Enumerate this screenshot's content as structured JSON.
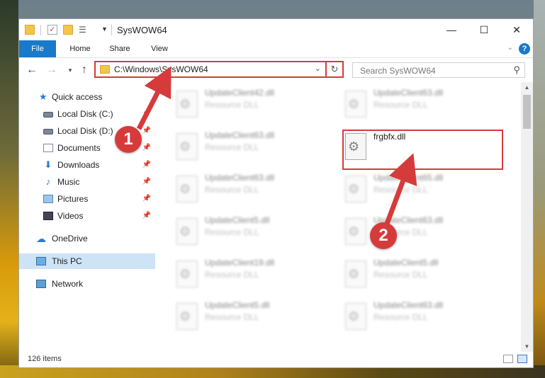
{
  "window": {
    "title": "SysWOW64",
    "controls": {
      "minimize": "—",
      "maximize": "☐",
      "close": "✕"
    }
  },
  "ribbon": {
    "tabs": [
      "File",
      "Home",
      "Share",
      "View"
    ]
  },
  "address": {
    "path": "C:\\Windows\\SysWOW64",
    "search_placeholder": "Search SysWOW64"
  },
  "nav": {
    "items": [
      {
        "label": "Quick access",
        "icon": "star-icon"
      },
      {
        "label": "Local Disk (C:)",
        "icon": "drive-icon",
        "pinned": true
      },
      {
        "label": "Local Disk (D:)",
        "icon": "drive-icon",
        "pinned": true
      },
      {
        "label": "Documents",
        "icon": "documents-icon",
        "pinned": true
      },
      {
        "label": "Downloads",
        "icon": "downloads-icon",
        "pinned": true
      },
      {
        "label": "Music",
        "icon": "music-icon",
        "pinned": true
      },
      {
        "label": "Pictures",
        "icon": "pictures-icon",
        "pinned": true
      },
      {
        "label": "Videos",
        "icon": "videos-icon",
        "pinned": true
      },
      {
        "label": "OneDrive",
        "icon": "onedrive-icon"
      },
      {
        "label": "This PC",
        "icon": "this-pc-icon",
        "selected": true
      },
      {
        "label": "Network",
        "icon": "network-icon"
      }
    ]
  },
  "files": {
    "left_column": [
      {
        "name": "UpdateClient42.dll",
        "type": "Resource DLL"
      },
      {
        "name": "UpdateClient63.dll",
        "type": "Resource DLL"
      },
      {
        "name": "UpdateClient63.dll",
        "type": "Resource DLL"
      },
      {
        "name": "UpdateClient5.dll",
        "type": "Resource DLL"
      },
      {
        "name": "UpdateClient19.dll",
        "type": "Resource DLL"
      },
      {
        "name": "UpdateClient5.dll",
        "type": "Resource DLL"
      }
    ],
    "right_column": [
      {
        "name": "UpdateClient63.dll",
        "type": "Resource DLL"
      },
      {
        "name": "frgbfx.dll",
        "type": "",
        "highlighted": true
      },
      {
        "name": "UpdateClient65.dll",
        "type": "Resource DLL"
      },
      {
        "name": "UpdateClient63.dll",
        "type": "Resource DLL"
      },
      {
        "name": "UpdateClient5.dll",
        "type": "Resource DLL"
      },
      {
        "name": "UpdateClient63.dll",
        "type": "Resource DLL"
      }
    ]
  },
  "status": {
    "item_count": "126 items"
  },
  "callouts": {
    "first": "1",
    "second": "2"
  },
  "colors": {
    "accent": "#1979ca",
    "highlight_red": "#d9393a"
  }
}
